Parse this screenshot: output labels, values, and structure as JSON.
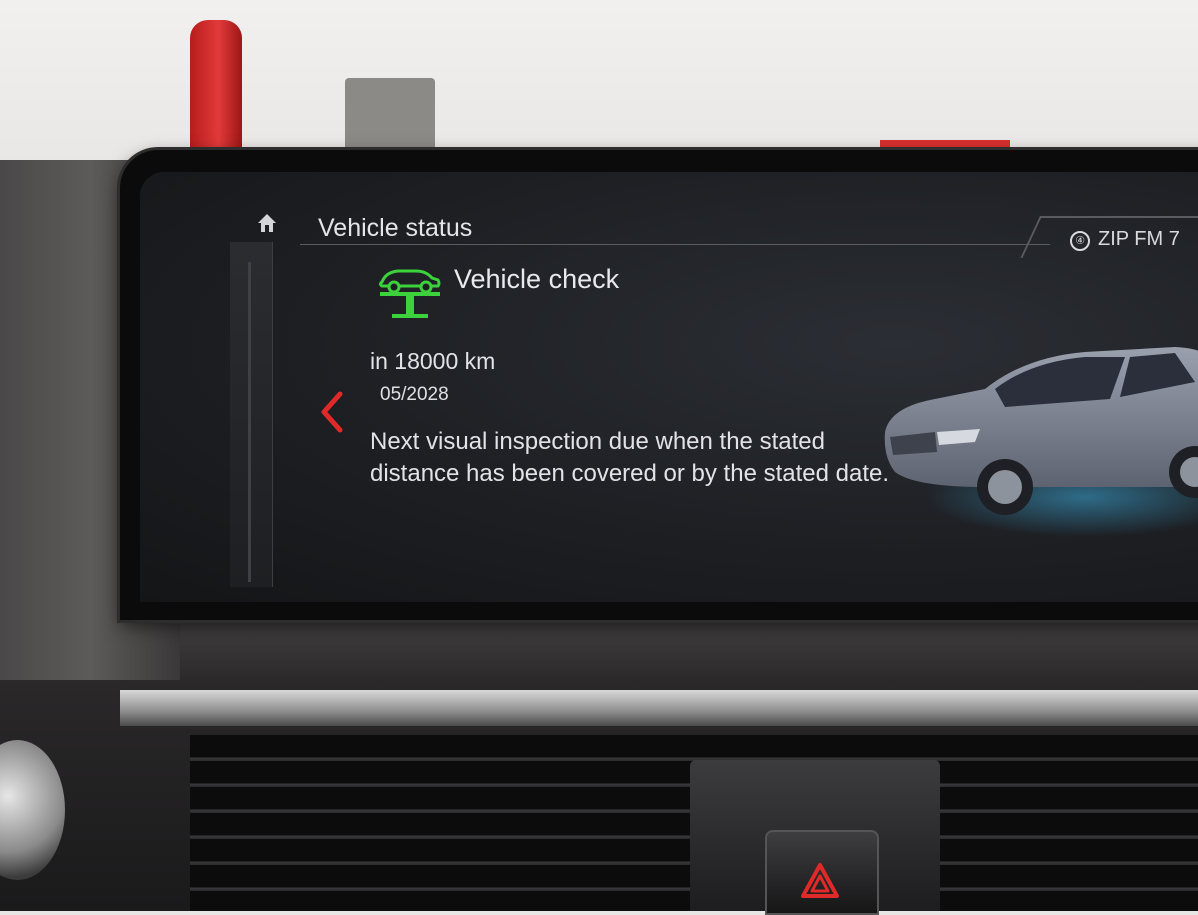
{
  "header": {
    "title": "Vehicle status",
    "radio_source_symbol": "④",
    "radio_station": "ZIP FM 7"
  },
  "service_item": {
    "title": "Vehicle check",
    "icon": "vehicle-lift-icon",
    "icon_color": "#3cd23c",
    "distance": "in 18000 km",
    "date": "05/2028",
    "description": "Next visual inspection due when the stated distance has been covered or by the stated date."
  },
  "icons": {
    "home": "home-icon",
    "back": "chevron-left-icon",
    "hazard": "hazard-triangle-icon"
  },
  "colors": {
    "accent_red": "#e02a2a",
    "status_green": "#3cd23c",
    "screen_bg": "#1d1f23"
  }
}
